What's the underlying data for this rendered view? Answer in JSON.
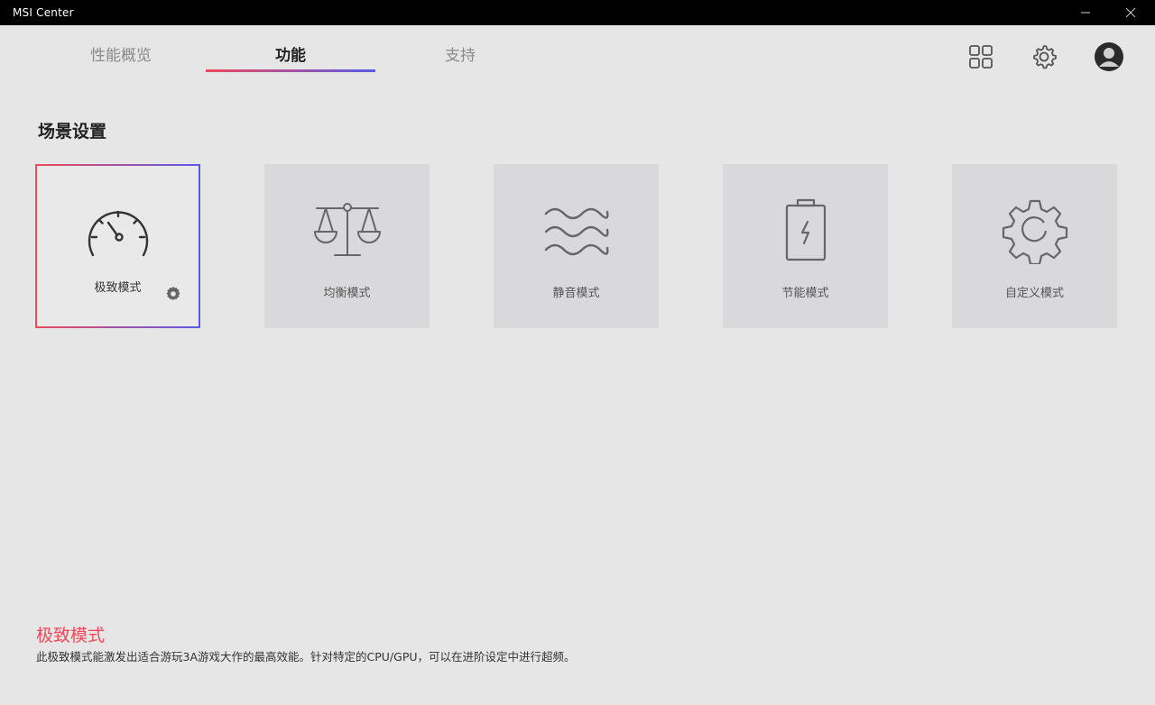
{
  "window": {
    "title": "MSI Center",
    "minimize_icon": "minimize-icon",
    "close_icon": "close-icon"
  },
  "tabs": [
    {
      "label": "性能概览",
      "active": false
    },
    {
      "label": "功能",
      "active": true
    },
    {
      "label": "支持",
      "active": false
    }
  ],
  "header_icons": [
    "apps-grid-icon",
    "gear-icon",
    "user-avatar-icon"
  ],
  "section": {
    "title": "场景设置"
  },
  "modes": [
    {
      "label": "极致模式",
      "icon": "speedometer-icon",
      "selected": true
    },
    {
      "label": "均衡模式",
      "icon": "balance-scale-icon",
      "selected": false
    },
    {
      "label": "静音模式",
      "icon": "waves-icon",
      "selected": false
    },
    {
      "label": "节能模式",
      "icon": "battery-icon",
      "selected": false
    },
    {
      "label": "自定义模式",
      "icon": "gear-icon",
      "selected": false
    }
  ],
  "description": {
    "title": "极致模式",
    "text": "此极致模式能激发出适合游玩3A游戏大作的最高效能。针对特定的CPU/GPU，可以在进阶设定中进行超频。"
  },
  "colors": {
    "accent_red": "#f04a5a",
    "accent_blue": "#5a5ae8",
    "background": "#e6e6e6",
    "card": "#d9d9db"
  }
}
